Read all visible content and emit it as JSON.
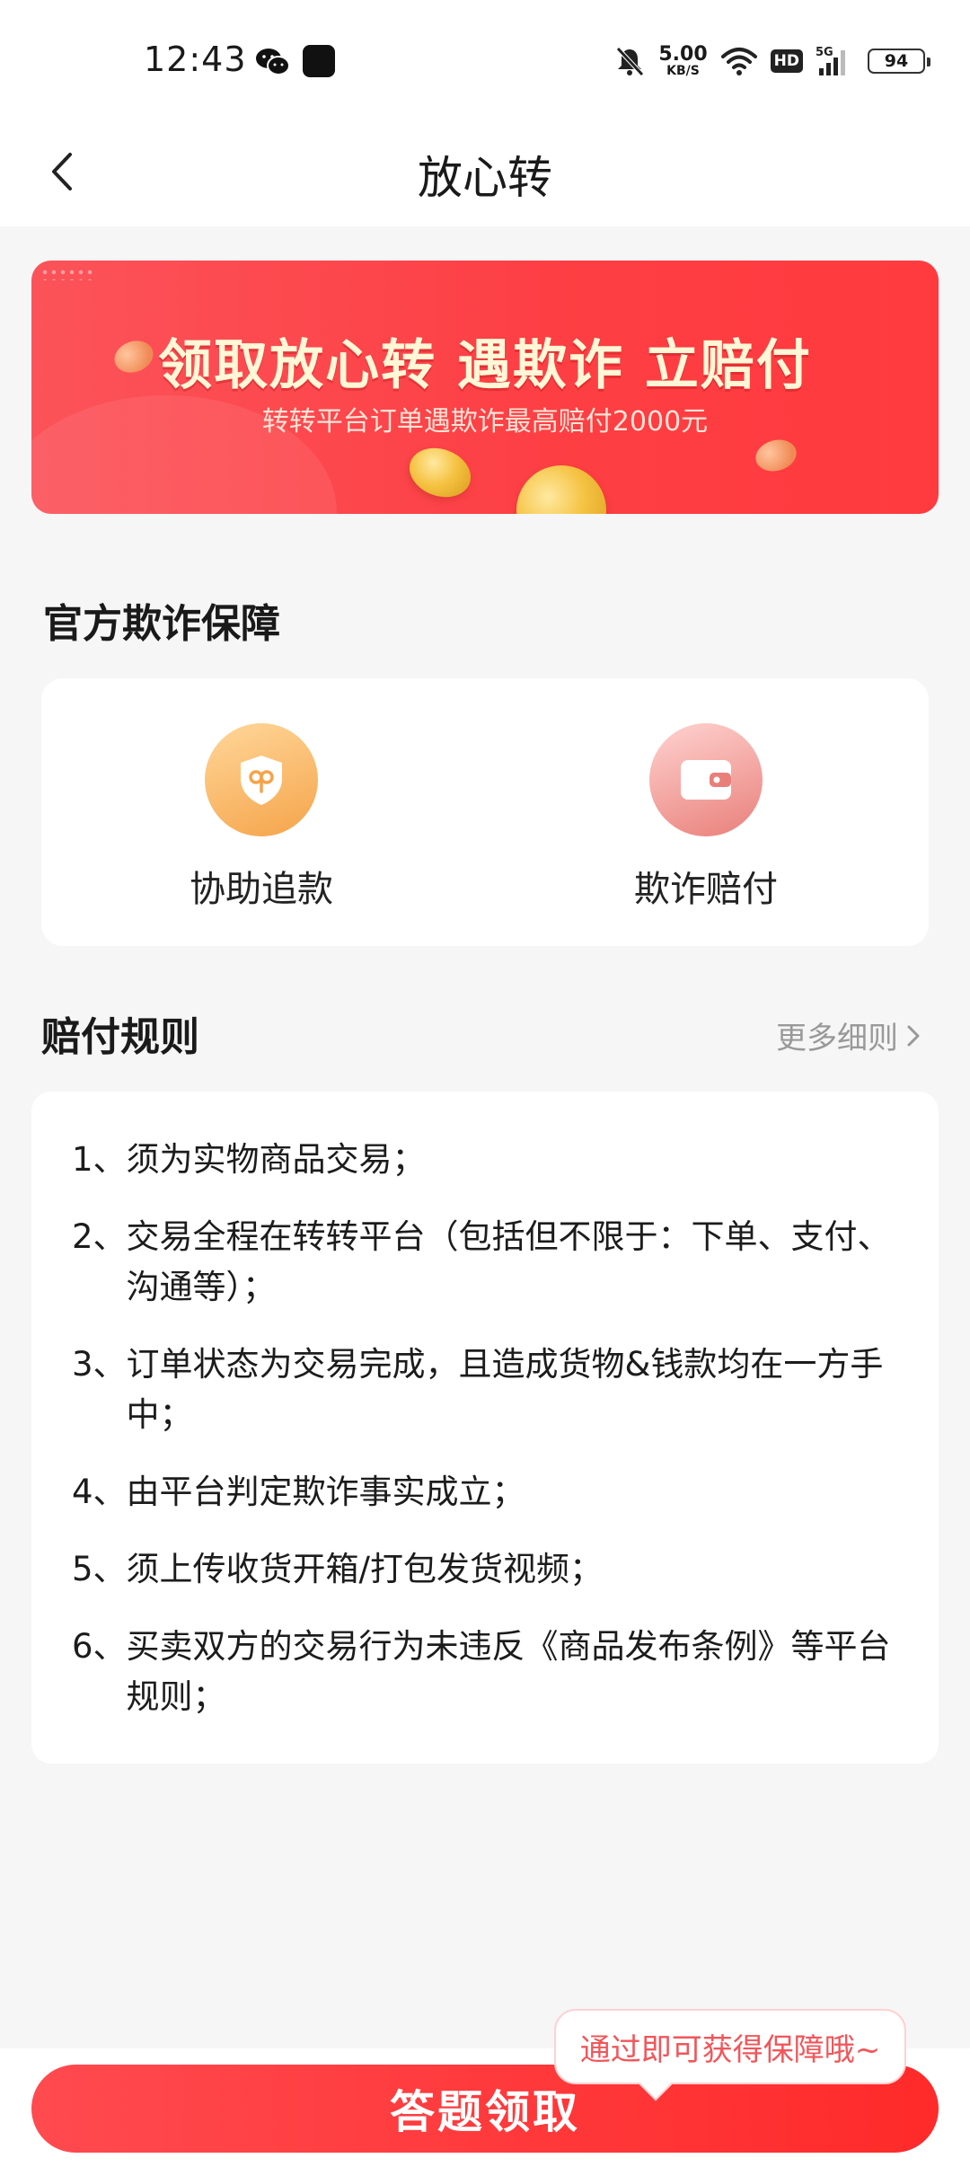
{
  "status_bar": {
    "time": "12:43",
    "net_speed_value": "5.00",
    "net_speed_unit": "KB/S",
    "hd": "HD",
    "network": "5G",
    "battery": "94",
    "icons": [
      "wechat-icon",
      "app-icon",
      "mute-icon",
      "wifi-icon",
      "signal-icon",
      "battery-icon"
    ]
  },
  "nav": {
    "title": "放心转",
    "back_icon": "chevron-left-icon"
  },
  "banner": {
    "title": "领取放心转  遇欺诈  立赔付",
    "subtitle": "转转平台订单遇欺诈最高赔付2000元"
  },
  "guarantee": {
    "heading": "官方欺诈保障",
    "items": [
      {
        "label": "协助追款",
        "icon": "shield-icon",
        "color": "#f5a44a"
      },
      {
        "label": "欺诈赔付",
        "icon": "wallet-icon",
        "color": "#e97f7a"
      }
    ]
  },
  "rules": {
    "heading": "赔付规则",
    "more_label": "更多细则",
    "items": [
      {
        "num": "1、",
        "text": "须为实物商品交易；"
      },
      {
        "num": "2、",
        "text": "交易全程在转转平台（包括但不限于：下单、支付、沟通等）；"
      },
      {
        "num": "3、",
        "text": "订单状态为交易完成，且造成货物&钱款均在一方手中；"
      },
      {
        "num": "4、",
        "text": "由平台判定欺诈事实成立；"
      },
      {
        "num": "5、",
        "text": "须上传收货开箱/打包发货视频；"
      },
      {
        "num": "6、",
        "text": "买卖双方的交易行为未违反《商品发布条例》等平台规则；"
      }
    ]
  },
  "bottom": {
    "cta_label": "答题领取",
    "tooltip": "通过即可获得保障哦~"
  },
  "colors": {
    "accent": "#ff3b3f",
    "background": "#f6f6f6",
    "muted_text": "#999999"
  }
}
